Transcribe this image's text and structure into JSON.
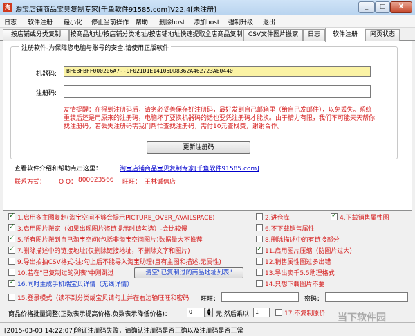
{
  "window": {
    "title": "淘宝店铺商品宝贝复制专家[千鱼软件91585.com]V22.4[未注册]",
    "min_label": "_",
    "max_label": "□",
    "close_label": "X"
  },
  "menu": [
    "日志",
    "软件注册",
    "最小化",
    "停止当前操作",
    "帮助",
    "删除host",
    "添加host",
    "强制升级",
    "退出"
  ],
  "tabs": [
    "按店铺或分类复制",
    "按商品地址/按店铺分类地址/按店铺地址快速提取全店商品复制",
    "CSV文件图片搬家",
    "日志",
    "软件注册",
    "网页状态"
  ],
  "registration": {
    "legend": "注册软件-为保障您电脑与账号的安全,请使用正版软件",
    "machine_label": "机器码:",
    "machine_code": "BFEBFBFF000206A7--9F021D1E14105DD8362A462723AE0440",
    "code_label": "注册码:",
    "code_value": "",
    "tip": "友情提醒：在得到注册码后，请务必妥善保存好注册码，最好发到自己邮箱里（给自己发邮件），以免丢失。系统重装后还是用原来的注册码，电脑坏了要换机器码的话也要凭注册码才能换。由于精力有限，我们不可能天天帮你找注册码，若丢失注册码需我们帮忙查找注册码，需付10元查找费，谢谢合作。",
    "update_button": "更新注册码"
  },
  "info": {
    "help_label": "查看软件介绍和帮助点击这里：",
    "help_link": "淘宝店铺商品宝贝复制专家[千鱼软件91585.com]",
    "contact_label": "联系方式：",
    "qq_label": "Q Q：",
    "qq_value": "800023566",
    "wangwang_label": "旺旺：",
    "wangwang_value": "王林诚信店"
  },
  "options": {
    "opt1": "1.启用多主图复制(淘宝空间不够会提示PICTURE_OVER_AVAILSPACE)",
    "opt2": "2.进仓库",
    "opt3": "3.启用图片搬家（如果出现图片盗链提示时请勾选）-会比较慢",
    "opt4": "4.下载销售属性图",
    "opt5": "5.所有图片搬到自己淘宝空间(包括非淘宝空间图片)数据量大不推荐",
    "opt6": "6.不下载销售属性",
    "opt7": "7.删除描述中的链接地址(仅删除链接地址，不删除文字和图片)",
    "opt8": "8.删除描述中的有链接部分",
    "opt9": "9.导出拍拍CSV格式-注:勾上后不能导入淘宝助理(且有主图和描述,无属性)",
    "opt10": "10.若在\"已复制过的列表\"中则跳过",
    "opt11": "11.启用图片压缩（防图片过大）",
    "opt12": "12.销售属性图过多出错",
    "opt13": "13.导出卖千5.5助理格式",
    "opt14": "14.只想下载图片不要",
    "opt15": "15.登录模式（读不到分类或宝贝请勾上并在右边输旺旺和密码",
    "opt16": "16.同时生成手机端宝贝详情（无线详情）",
    "opt17": "17.不复制原价",
    "clear_button": "清空\"已复制过的商品地址列表\"",
    "wangwang_label": "旺旺：",
    "password_label": "密码：",
    "price_label": "商品价格批量调整(正数表示提高价格,负数表示降低价格)：",
    "price_value": "0",
    "price_unit": "元,然后乘以",
    "multiplier_value": "1"
  },
  "status": {
    "text": "[2015-03-03 14:22:07]验证注册码失败，请确认注册码是否正确以及注册码是否正常"
  },
  "watermark": "当下软件园"
}
